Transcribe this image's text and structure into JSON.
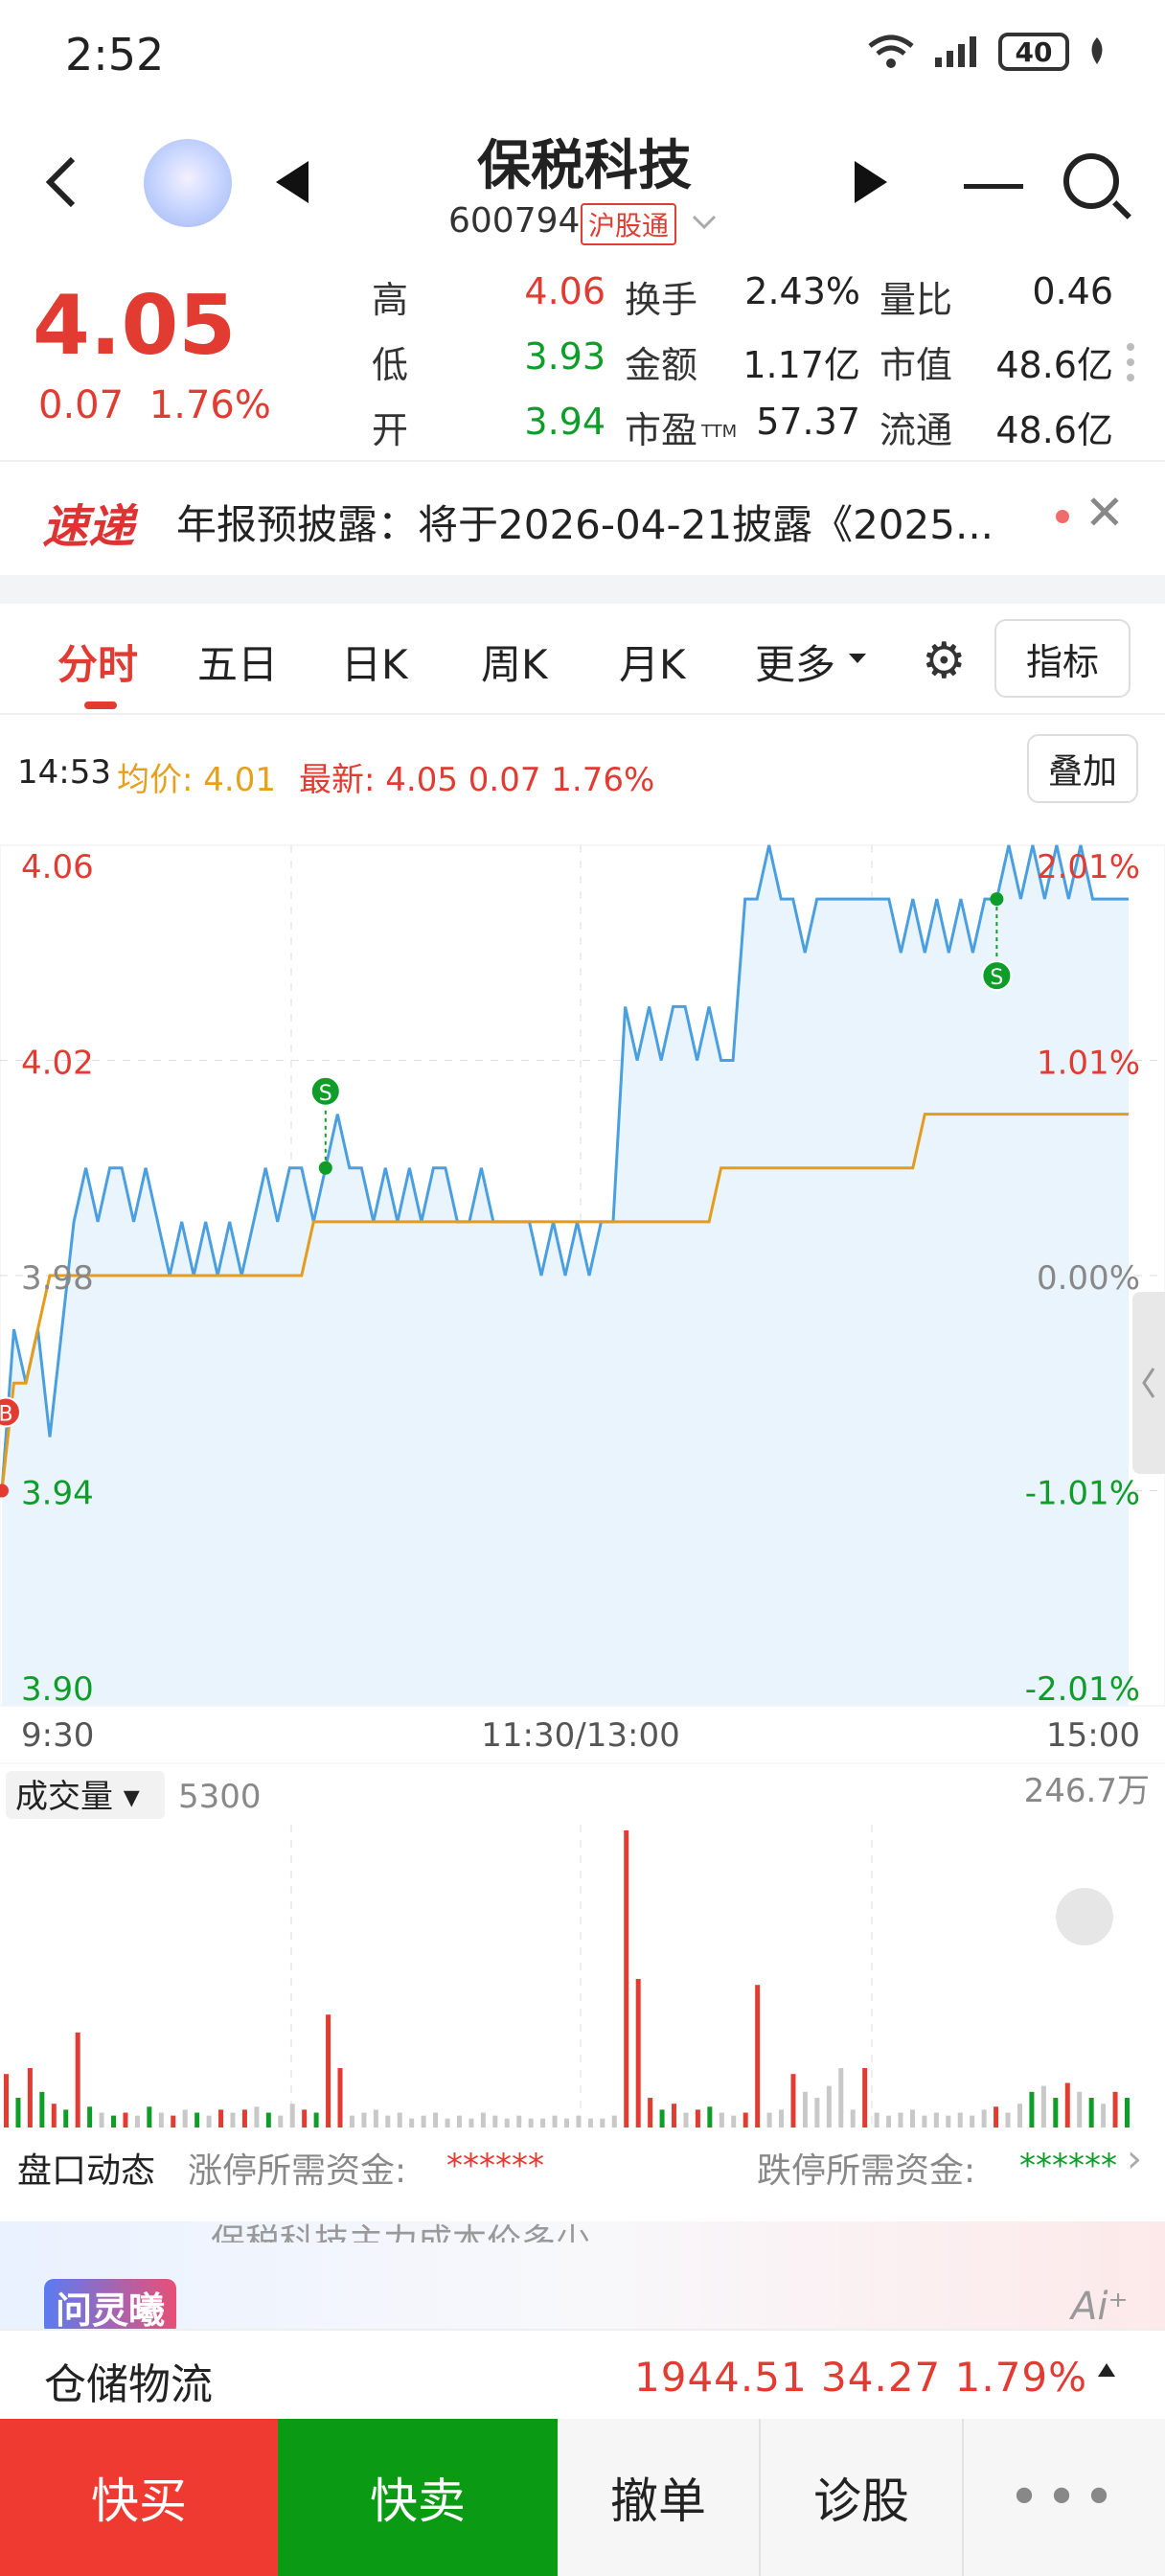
{
  "status": {
    "time": "2:52",
    "battery": "40"
  },
  "header": {
    "stock_name": "保税科技",
    "stock_code": "600794",
    "market_badge": "沪股通"
  },
  "quote": {
    "price": "4.05",
    "change": "0.07",
    "change_pct": "1.76%",
    "fields": [
      {
        "label": "高",
        "value": "4.06",
        "color": "red"
      },
      {
        "label": "换手",
        "value": "2.43%",
        "color": "normal"
      },
      {
        "label": "量比",
        "value": "0.46",
        "color": "normal"
      },
      {
        "label": "低",
        "value": "3.93",
        "color": "green"
      },
      {
        "label": "金额",
        "value": "1.17亿",
        "color": "normal"
      },
      {
        "label": "市值",
        "value": "48.6亿",
        "color": "normal"
      },
      {
        "label": "开",
        "value": "3.94",
        "color": "green"
      },
      {
        "label": "市盈",
        "label_sub": "TTM",
        "value": "57.37",
        "color": "normal"
      },
      {
        "label": "流通",
        "value": "48.6亿",
        "color": "normal"
      }
    ]
  },
  "news": {
    "logo": "速递",
    "text": "年报预披露：将于2026-04-21披露《2025..."
  },
  "tabs": [
    "分时",
    "五日",
    "日K",
    "周K",
    "月K",
    "更多"
  ],
  "tab_active": "分时",
  "buttons": {
    "indicator": "指标",
    "overlay": "叠加"
  },
  "info_row": {
    "time": "14:53",
    "avg_label": "均价:",
    "avg_value": "4.01",
    "latest_label": "最新:",
    "latest_value": "4.05 0.07 1.76%"
  },
  "chart_data": {
    "type": "line",
    "title": "",
    "y_price_ticks": [
      "4.06",
      "4.02",
      "3.98",
      "3.94",
      "3.90"
    ],
    "y_pct_ticks": [
      "2.01%",
      "1.01%",
      "0.00%",
      "-1.01%",
      "-2.01%"
    ],
    "x_ticks": [
      "9:30",
      "11:30/13:00",
      "15:00"
    ],
    "ylim": [
      3.9,
      4.06
    ],
    "prev_close": 3.98,
    "series": [
      {
        "name": "",
        "color": "#4a9fe0",
        "values": [
          3.94,
          3.97,
          3.96,
          3.97,
          3.95,
          3.97,
          3.99,
          4.0,
          3.99,
          4.0,
          4.0,
          3.99,
          4.0,
          3.99,
          3.98,
          3.99,
          3.98,
          3.99,
          3.98,
          3.99,
          3.98,
          3.99,
          4.0,
          3.99,
          4.0,
          4.0,
          3.99,
          4.0,
          4.01,
          4.0,
          4.0,
          3.99,
          4.0,
          3.99,
          4.0,
          3.99,
          4.0,
          4.0,
          3.99,
          3.99,
          4.0,
          3.99,
          3.99,
          3.99,
          3.99,
          3.98,
          3.99,
          3.98,
          3.99,
          3.98,
          3.99,
          3.99,
          4.03,
          4.02,
          4.03,
          4.02,
          4.03,
          4.03,
          4.02,
          4.03,
          4.02,
          4.02,
          4.05,
          4.05,
          4.06,
          4.05,
          4.05,
          4.04,
          4.05,
          4.05,
          4.05,
          4.05,
          4.05,
          4.05,
          4.05,
          4.04,
          4.05,
          4.04,
          4.05,
          4.04,
          4.05,
          4.04,
          4.05,
          4.05,
          4.06,
          4.05,
          4.06,
          4.05,
          4.06,
          4.05,
          4.06,
          4.05,
          4.05,
          4.05,
          4.05
        ]
      },
      {
        "name": "",
        "color": "#e59b1b",
        "values": [
          3.94,
          3.96,
          3.96,
          3.97,
          3.98,
          3.98,
          3.98,
          3.98,
          3.98,
          3.98,
          3.98,
          3.98,
          3.98,
          3.98,
          3.98,
          3.98,
          3.98,
          3.98,
          3.98,
          3.98,
          3.98,
          3.98,
          3.98,
          3.98,
          3.98,
          3.98,
          3.99,
          3.99,
          3.99,
          3.99,
          3.99,
          3.99,
          3.99,
          3.99,
          3.99,
          3.99,
          3.99,
          3.99,
          3.99,
          3.99,
          3.99,
          3.99,
          3.99,
          3.99,
          3.99,
          3.99,
          3.99,
          3.99,
          3.99,
          3.99,
          3.99,
          3.99,
          3.99,
          3.99,
          3.99,
          3.99,
          3.99,
          3.99,
          3.99,
          3.99,
          4.0,
          4.0,
          4.0,
          4.0,
          4.0,
          4.0,
          4.0,
          4.0,
          4.0,
          4.0,
          4.0,
          4.0,
          4.0,
          4.0,
          4.0,
          4.0,
          4.0,
          4.01,
          4.01,
          4.01,
          4.01,
          4.01,
          4.01,
          4.01,
          4.01,
          4.01,
          4.01,
          4.01,
          4.01,
          4.01,
          4.01,
          4.01,
          4.01,
          4.01,
          4.01
        ]
      }
    ],
    "markers": [
      {
        "label": "B",
        "color": "#e23b32",
        "index": 0
      },
      {
        "label": "S",
        "color": "#0f9d2a",
        "index": 27
      },
      {
        "label": "S",
        "color": "#0f9d2a",
        "index": 83
      }
    ],
    "volume": {
      "label": "成交量",
      "value": "5300",
      "max_label": "246.7万",
      "bars": [
        {
          "v": 0.18,
          "c": "r"
        },
        {
          "v": 0.1,
          "c": "g"
        },
        {
          "v": 0.2,
          "c": "r"
        },
        {
          "v": 0.12,
          "c": "g"
        },
        {
          "v": 0.08,
          "c": "r"
        },
        {
          "v": 0.06,
          "c": "g"
        },
        {
          "v": 0.32,
          "c": "r"
        },
        {
          "v": 0.07,
          "c": "g"
        },
        {
          "v": 0.05,
          "c": "gy"
        },
        {
          "v": 0.04,
          "c": "g"
        },
        {
          "v": 0.05,
          "c": "r"
        },
        {
          "v": 0.04,
          "c": "gy"
        },
        {
          "v": 0.07,
          "c": "g"
        },
        {
          "v": 0.05,
          "c": "gy"
        },
        {
          "v": 0.04,
          "c": "r"
        },
        {
          "v": 0.06,
          "c": "gy"
        },
        {
          "v": 0.05,
          "c": "g"
        },
        {
          "v": 0.04,
          "c": "gy"
        },
        {
          "v": 0.06,
          "c": "r"
        },
        {
          "v": 0.05,
          "c": "gy"
        },
        {
          "v": 0.06,
          "c": "r"
        },
        {
          "v": 0.07,
          "c": "gy"
        },
        {
          "v": 0.05,
          "c": "g"
        },
        {
          "v": 0.04,
          "c": "gy"
        },
        {
          "v": 0.08,
          "c": "gy"
        },
        {
          "v": 0.06,
          "c": "r"
        },
        {
          "v": 0.05,
          "c": "g"
        },
        {
          "v": 0.38,
          "c": "r"
        },
        {
          "v": 0.2,
          "c": "r"
        },
        {
          "v": 0.04,
          "c": "gy"
        },
        {
          "v": 0.05,
          "c": "gy"
        },
        {
          "v": 0.06,
          "c": "gy"
        },
        {
          "v": 0.04,
          "c": "gy"
        },
        {
          "v": 0.05,
          "c": "gy"
        },
        {
          "v": 0.03,
          "c": "gy"
        },
        {
          "v": 0.04,
          "c": "gy"
        },
        {
          "v": 0.05,
          "c": "gy"
        },
        {
          "v": 0.03,
          "c": "gy"
        },
        {
          "v": 0.04,
          "c": "gy"
        },
        {
          "v": 0.03,
          "c": "gy"
        },
        {
          "v": 0.05,
          "c": "gy"
        },
        {
          "v": 0.04,
          "c": "gy"
        },
        {
          "v": 0.03,
          "c": "gy"
        },
        {
          "v": 0.04,
          "c": "gy"
        },
        {
          "v": 0.03,
          "c": "gy"
        },
        {
          "v": 0.03,
          "c": "gy"
        },
        {
          "v": 0.04,
          "c": "gy"
        },
        {
          "v": 0.03,
          "c": "gy"
        },
        {
          "v": 0.04,
          "c": "gy"
        },
        {
          "v": 0.03,
          "c": "gy"
        },
        {
          "v": 0.03,
          "c": "gy"
        },
        {
          "v": 0.04,
          "c": "gy"
        },
        {
          "v": 1.0,
          "c": "r"
        },
        {
          "v": 0.5,
          "c": "r"
        },
        {
          "v": 0.1,
          "c": "r"
        },
        {
          "v": 0.06,
          "c": "g"
        },
        {
          "v": 0.08,
          "c": "r"
        },
        {
          "v": 0.05,
          "c": "gy"
        },
        {
          "v": 0.06,
          "c": "r"
        },
        {
          "v": 0.07,
          "c": "g"
        },
        {
          "v": 0.05,
          "c": "gy"
        },
        {
          "v": 0.04,
          "c": "gy"
        },
        {
          "v": 0.05,
          "c": "r"
        },
        {
          "v": 0.48,
          "c": "r"
        },
        {
          "v": 0.05,
          "c": "gy"
        },
        {
          "v": 0.06,
          "c": "gy"
        },
        {
          "v": 0.18,
          "c": "r"
        },
        {
          "v": 0.12,
          "c": "gy"
        },
        {
          "v": 0.1,
          "c": "gy"
        },
        {
          "v": 0.14,
          "c": "gy"
        },
        {
          "v": 0.2,
          "c": "gy"
        },
        {
          "v": 0.06,
          "c": "gy"
        },
        {
          "v": 0.2,
          "c": "r"
        },
        {
          "v": 0.05,
          "c": "gy"
        },
        {
          "v": 0.04,
          "c": "gy"
        },
        {
          "v": 0.05,
          "c": "gy"
        },
        {
          "v": 0.06,
          "c": "gy"
        },
        {
          "v": 0.04,
          "c": "gy"
        },
        {
          "v": 0.05,
          "c": "gy"
        },
        {
          "v": 0.04,
          "c": "gy"
        },
        {
          "v": 0.05,
          "c": "gy"
        },
        {
          "v": 0.04,
          "c": "gy"
        },
        {
          "v": 0.06,
          "c": "gy"
        },
        {
          "v": 0.07,
          "c": "r"
        },
        {
          "v": 0.05,
          "c": "gy"
        },
        {
          "v": 0.08,
          "c": "gy"
        },
        {
          "v": 0.12,
          "c": "g"
        },
        {
          "v": 0.14,
          "c": "gy"
        },
        {
          "v": 0.1,
          "c": "g"
        },
        {
          "v": 0.15,
          "c": "r"
        },
        {
          "v": 0.12,
          "c": "gy"
        },
        {
          "v": 0.1,
          "c": "g"
        },
        {
          "v": 0.08,
          "c": "gy"
        },
        {
          "v": 0.12,
          "c": "r"
        },
        {
          "v": 0.1,
          "c": "g"
        }
      ]
    }
  },
  "panel": {
    "label": "盘口动态",
    "limit_up_label": "涨停所需资金:",
    "limit_up_value": "******",
    "limit_down_label": "跌停所需资金:",
    "limit_down_value": "******"
  },
  "ai": {
    "badge": "问灵曦",
    "peek": "保税科技主力成本价多少"
  },
  "sector": {
    "name": "仓储物流",
    "value": "1944.51  34.27  1.79%"
  },
  "bottom_bar": {
    "buy": "快买",
    "sell": "快卖",
    "cancel": "撤单",
    "diagnose": "诊股",
    "more": "•••"
  }
}
